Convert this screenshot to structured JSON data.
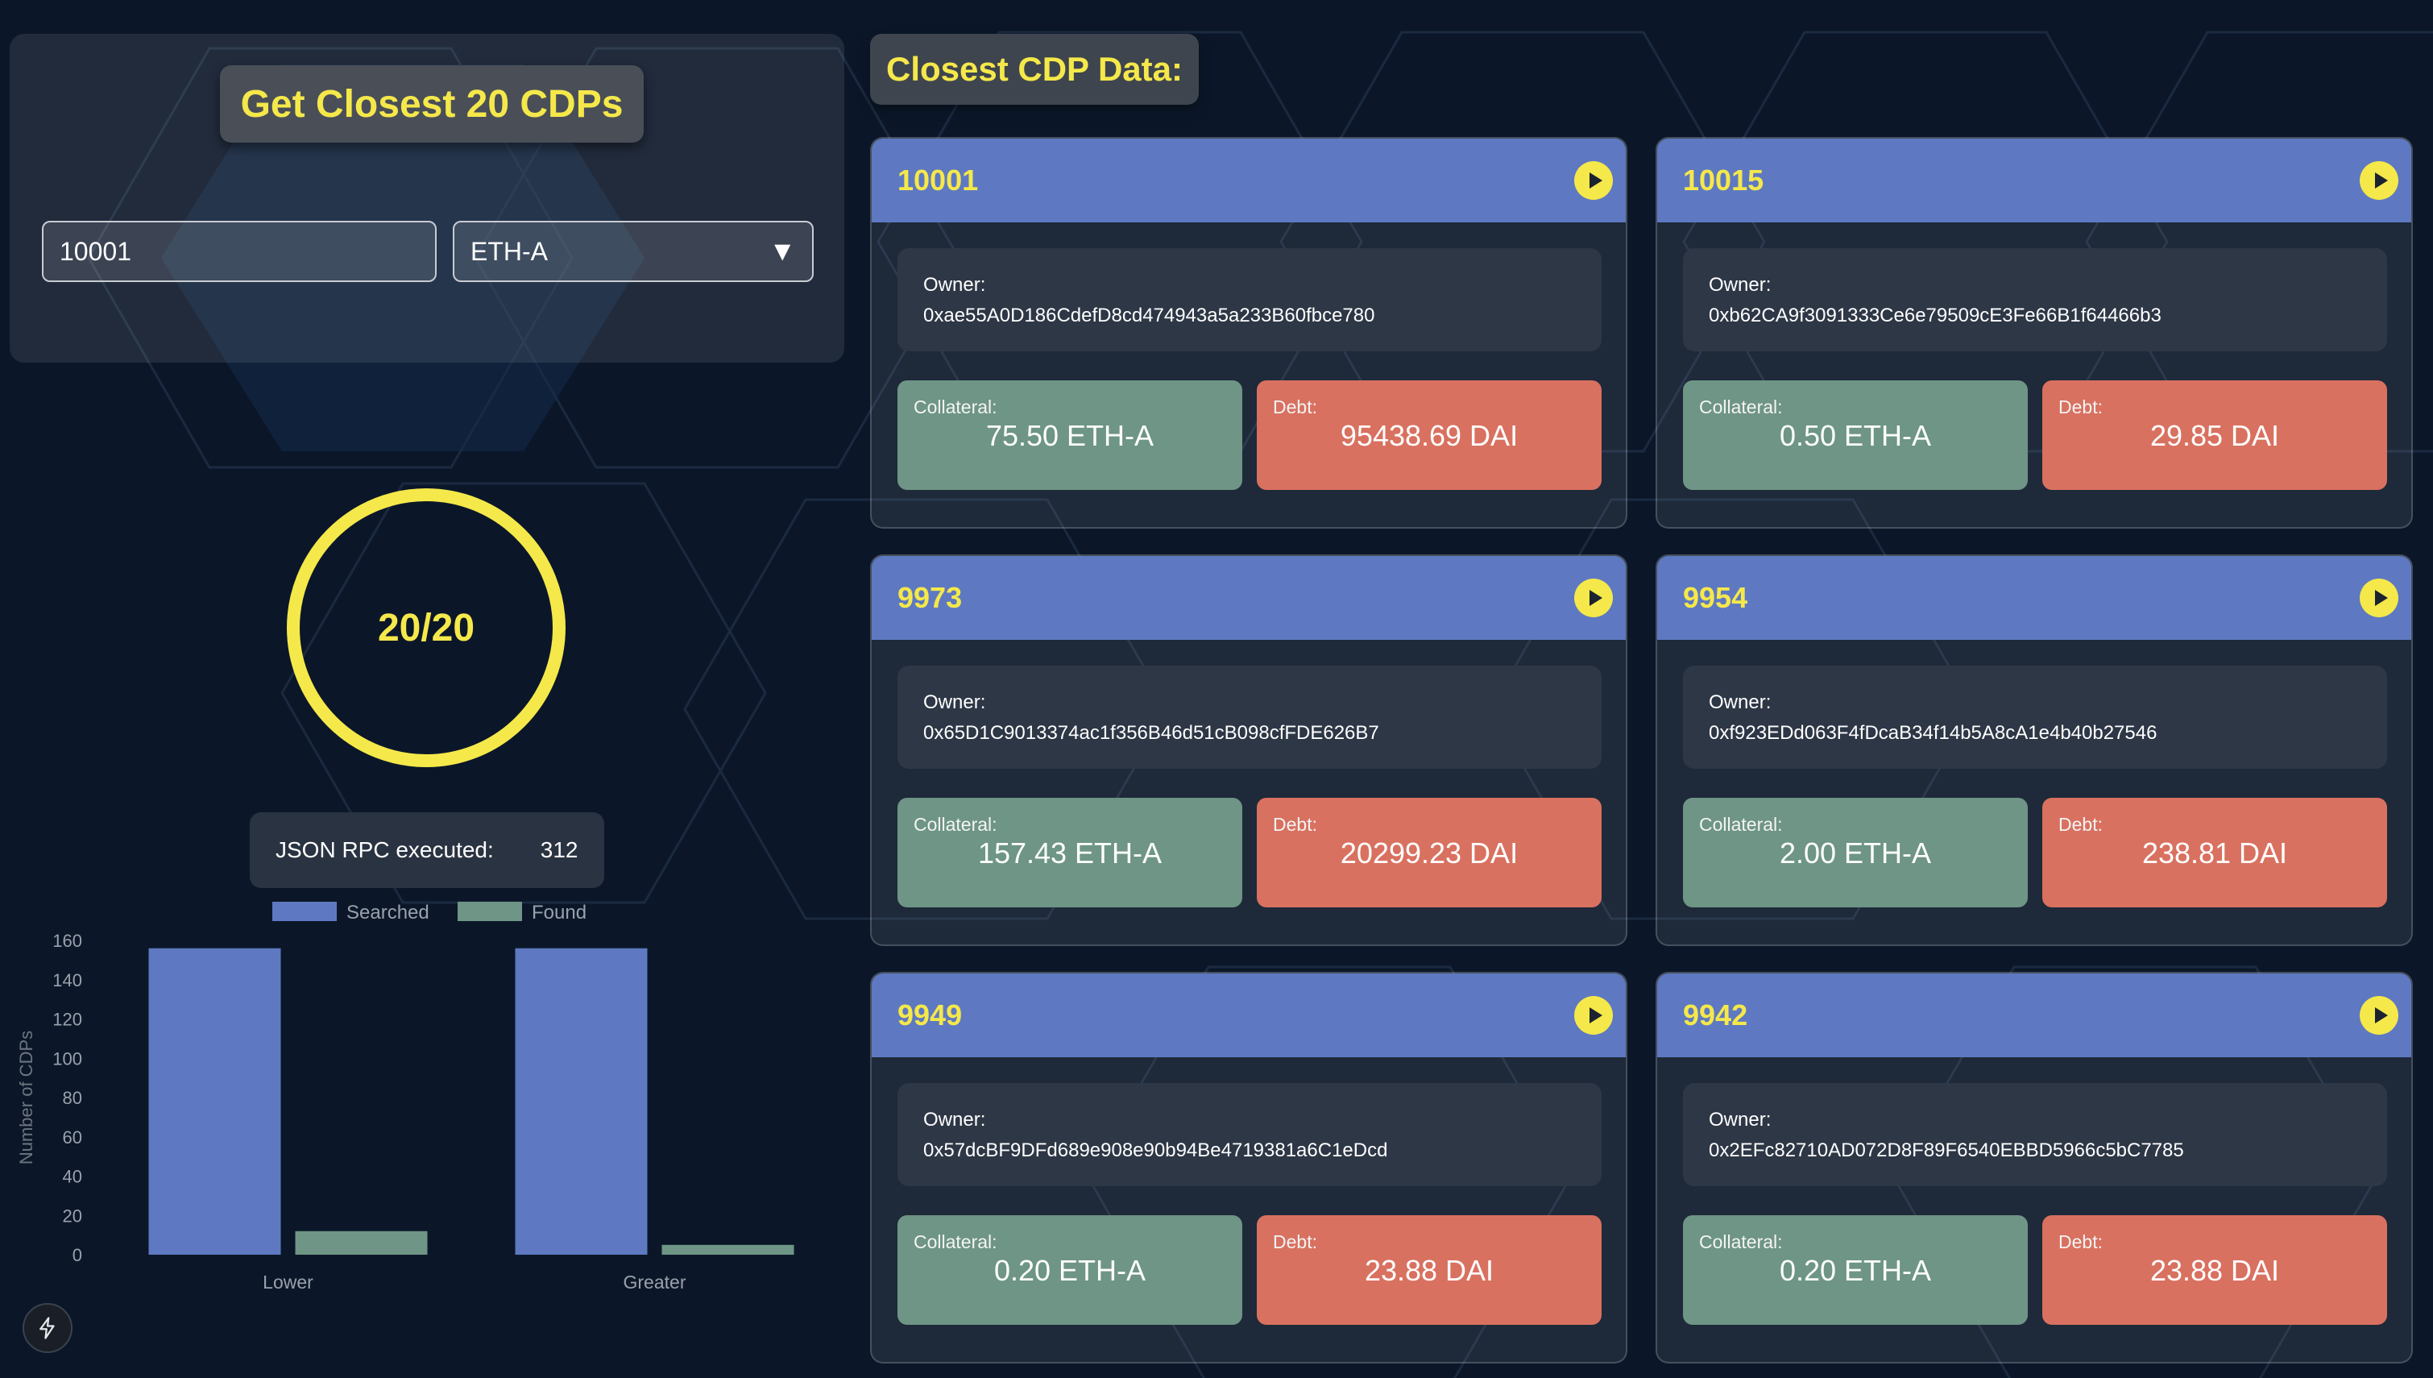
{
  "search": {
    "button_label": "Get Closest 20 CDPs",
    "cdp_id_value": "10001",
    "collateral_type_selected": "ETH-A"
  },
  "progress": {
    "text": "20/20",
    "fraction": 1.0,
    "color": "#f5e84a"
  },
  "rpc": {
    "label": "JSON RPC executed:",
    "value": "312"
  },
  "results": {
    "title": "Closest CDP Data:"
  },
  "labels": {
    "owner": "Owner:",
    "collateral": "Collateral:",
    "debt": "Debt:"
  },
  "cards": [
    {
      "id": "10001",
      "owner": "0xae55A0D186CdefD8cd474943a5a233B60fbce780",
      "collateral": "75.50 ETH-A",
      "debt": "95438.69 DAI"
    },
    {
      "id": "10015",
      "owner": "0xb62CA9f3091333Ce6e79509cE3Fe66B1f64466b3",
      "collateral": "0.50 ETH-A",
      "debt": "29.85 DAI"
    },
    {
      "id": "9973",
      "owner": "0x65D1C9013374ac1f356B46d51cB098cfFDE626B7",
      "collateral": "157.43 ETH-A",
      "debt": "20299.23 DAI"
    },
    {
      "id": "9954",
      "owner": "0xf923EDd063F4fDcaB34f14b5A8cA1e4b40b27546",
      "collateral": "2.00 ETH-A",
      "debt": "238.81 DAI"
    },
    {
      "id": "9949",
      "owner": "0x57dcBF9DFd689e908e90b94Be4719381a6C1eDcd",
      "collateral": "0.20 ETH-A",
      "debt": "23.88 DAI"
    },
    {
      "id": "9942",
      "owner": "0x2EFc82710AD072D8F89F6540EBBD5966c5bC7785",
      "collateral": "0.20 ETH-A",
      "debt": "23.88 DAI"
    }
  ],
  "colors": {
    "accent_yellow": "#f5e84a",
    "card_header": "#5e79c1",
    "collateral": "#6e9585",
    "debt": "#d97160",
    "background": "#0b1729"
  },
  "icons": {
    "card_action": "play-icon",
    "bottom_left": "flash-icon",
    "select": "caret-down-icon"
  },
  "chart_data": {
    "type": "bar",
    "categories": [
      "Lower",
      "Greater"
    ],
    "series": [
      {
        "name": "Searched",
        "values": [
          156,
          156
        ],
        "color": "#5e79c1"
      },
      {
        "name": "Found",
        "values": [
          12,
          5
        ],
        "color": "#6e9585"
      }
    ],
    "xlabel": "",
    "ylabel": "Number of CDPs",
    "ylim": [
      0,
      160
    ],
    "yticks": [
      0,
      20,
      40,
      60,
      80,
      100,
      120,
      140,
      160
    ],
    "legend_position": "top",
    "grid": false
  }
}
